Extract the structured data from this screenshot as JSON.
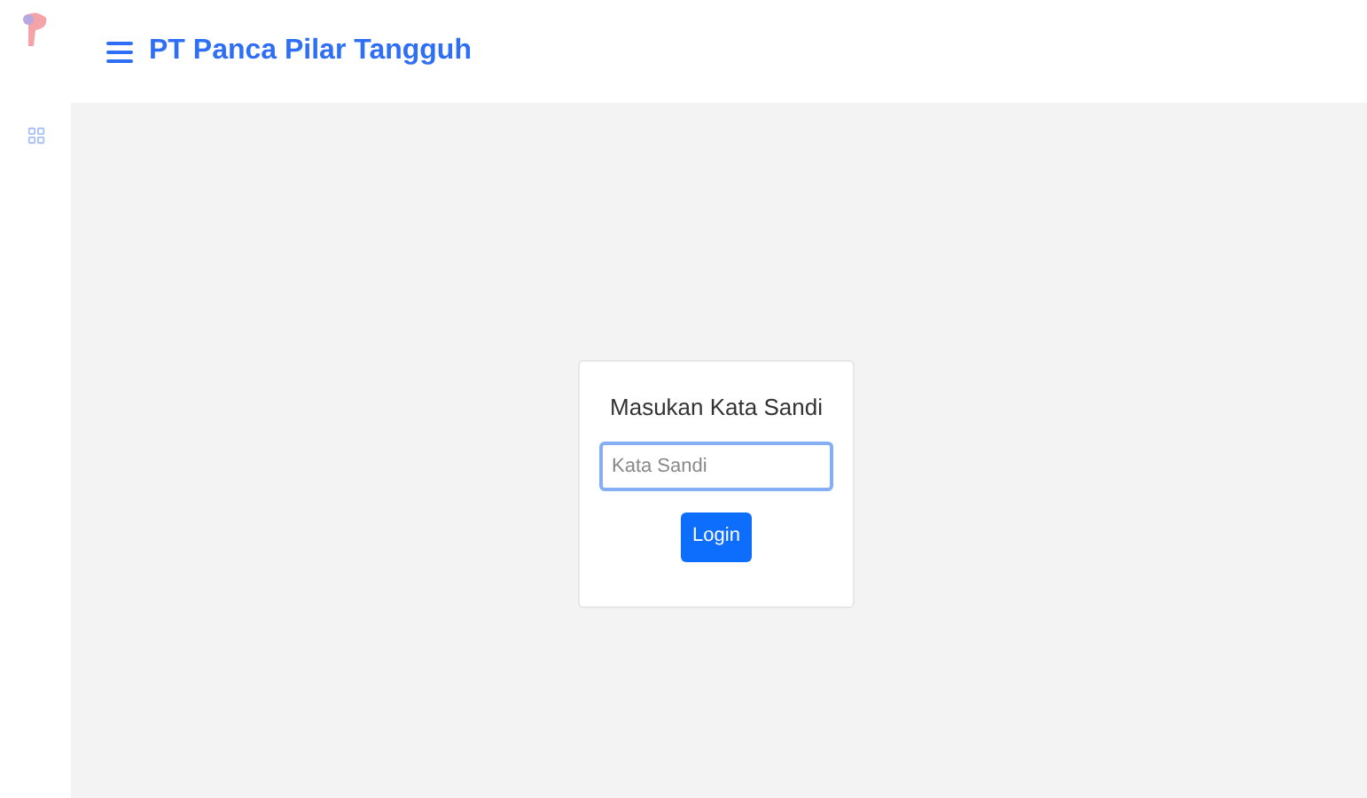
{
  "header": {
    "title": "PT Panca Pilar Tangguh"
  },
  "login": {
    "heading": "Masukan Kata Sandi",
    "password_field": {
      "placeholder": "Kata Sandi"
    },
    "button": "Login"
  }
}
